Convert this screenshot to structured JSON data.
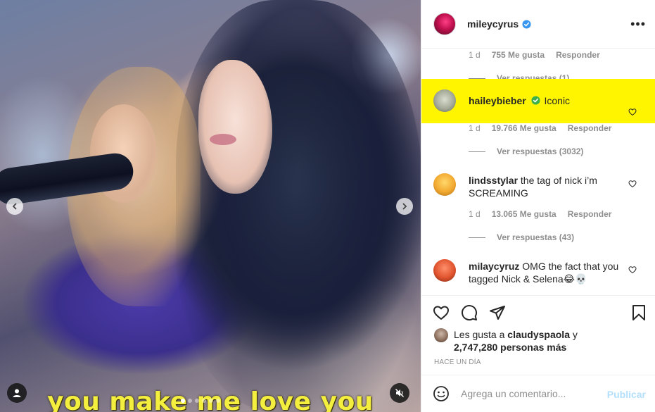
{
  "media": {
    "caption": "you make me love you",
    "slide_count": 6,
    "active_slide": 1
  },
  "post": {
    "author": "mileycyrus",
    "author_verified": true,
    "more_icon": "more-horizontal-icon"
  },
  "comments": {
    "first_meta": {
      "time": "1 d",
      "likes": "755 Me gusta",
      "reply": "Responder"
    },
    "first_view_replies": "Ver respuestas (1)",
    "items": [
      {
        "username": "haileybieber",
        "verified": true,
        "text": "Iconic",
        "highlight_color": "#fff500",
        "time": "1 d",
        "likes": "19.766 Me gusta",
        "reply": "Responder",
        "view_replies": "Ver respuestas (3032)"
      },
      {
        "username": "lindsstylar",
        "verified": false,
        "text": "the tag of nick i’m SCREAMING",
        "time": "1 d",
        "likes": "13.065 Me gusta",
        "reply": "Responder",
        "view_replies": "Ver respuestas (43)"
      },
      {
        "username": "milaycyruz",
        "verified": false,
        "text": "OMG the fact that you tagged Nick & Selena😂💀"
      }
    ]
  },
  "actions": {
    "like_icon": "heart-icon",
    "comment_icon": "comment-icon",
    "share_icon": "share-icon",
    "save_icon": "bookmark-icon",
    "likes_prefix": "Les gusta a",
    "likes_user": "claudyspaola",
    "likes_and": "y",
    "likes_others": "2,747,280 personas más",
    "time_ago": "HACE UN DÍA"
  },
  "add_comment": {
    "placeholder": "Agrega un comentario...",
    "publish_label": "Publicar",
    "publish_color": "#b2dffc"
  },
  "colors": {
    "verified_blue": "#3897f0",
    "verified_green": "#3db04b",
    "muted_text": "#8e8e8e"
  }
}
